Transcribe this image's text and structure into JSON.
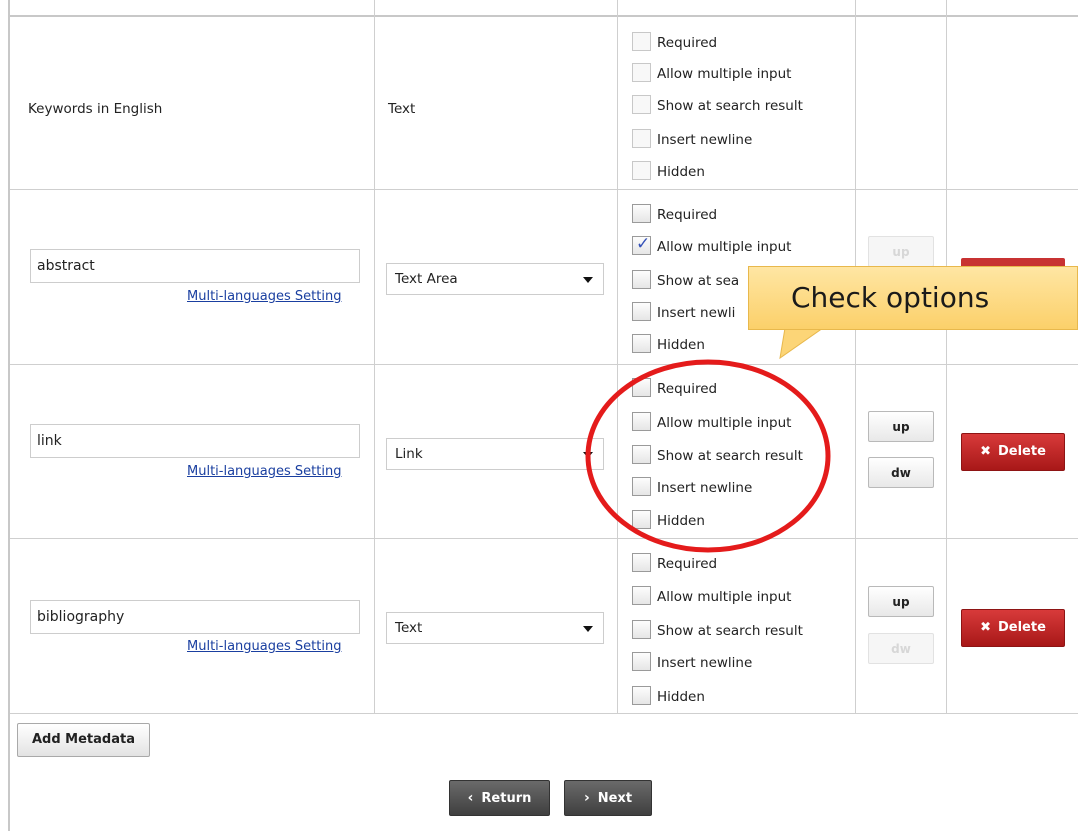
{
  "rows": [
    {
      "name_static": "Keywords in English",
      "type_static": "Text",
      "options": [
        {
          "label": "Required",
          "checked": false
        },
        {
          "label": "Allow multiple input",
          "checked": false
        },
        {
          "label": "Show at search result",
          "checked": false
        },
        {
          "label": "Insert newline",
          "checked": false
        },
        {
          "label": "Hidden",
          "checked": false
        }
      ]
    },
    {
      "name_value": "abstract",
      "ml_link": "Multi-languages Setting",
      "type_value": "Text Area",
      "options": [
        {
          "label": "Required",
          "checked": false
        },
        {
          "label": "Allow multiple input",
          "checked": true
        },
        {
          "label": "Show at sea",
          "checked": false
        },
        {
          "label": "Insert newli",
          "checked": false
        },
        {
          "label": "Hidden",
          "checked": false
        }
      ],
      "up_label": "up"
    },
    {
      "name_value": "link",
      "ml_link": "Multi-languages Setting",
      "type_value": "Link",
      "options": [
        {
          "label": "Required",
          "checked": false
        },
        {
          "label": "Allow multiple input",
          "checked": false
        },
        {
          "label": "Show at search result",
          "checked": false
        },
        {
          "label": "Insert newline",
          "checked": false
        },
        {
          "label": "Hidden",
          "checked": false
        }
      ],
      "up_label": "up",
      "dw_label": "dw",
      "delete_label": "Delete"
    },
    {
      "name_value": "bibliography",
      "ml_link": "Multi-languages Setting",
      "type_value": "Text",
      "options": [
        {
          "label": "Required",
          "checked": false
        },
        {
          "label": "Allow multiple input",
          "checked": false
        },
        {
          "label": "Show at search result",
          "checked": false
        },
        {
          "label": "Insert newline",
          "checked": false
        },
        {
          "label": "Hidden",
          "checked": false
        }
      ],
      "up_label": "up",
      "dw_label": "dw",
      "delete_label": "Delete"
    }
  ],
  "add_metadata_label": "Add Metadata",
  "return_label": "Return",
  "next_label": "Next",
  "callout_text": "Check options",
  "colors": {
    "delete_red": "#b82020",
    "callout_fill": "#fcd77b",
    "highlight_circle": "#e41b1b",
    "link_blue": "#1a3fa0"
  }
}
